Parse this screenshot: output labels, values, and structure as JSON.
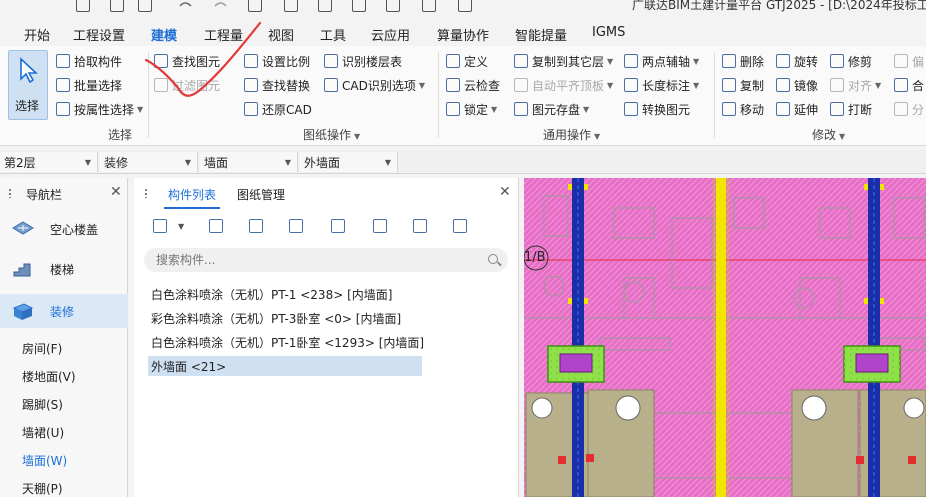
{
  "window": {
    "title": "广联达BIM土建计量平台 GTJ2025 - [D:\\2024年投标工"
  },
  "menu": {
    "tabs": [
      {
        "label": "开始"
      },
      {
        "label": "工程设置"
      },
      {
        "label": "建模",
        "active": true
      },
      {
        "label": "工程量"
      },
      {
        "label": "视图"
      },
      {
        "label": "工具"
      },
      {
        "label": "云应用"
      },
      {
        "label": "算量协作"
      },
      {
        "label": "智能提量"
      },
      {
        "label": "IGMS"
      }
    ]
  },
  "ribbon": {
    "select_group": {
      "label": "选择",
      "select_button": "选择",
      "pick_component": "拾取构件",
      "batch_select": "批量选择",
      "select_by_property": "按属性选择"
    },
    "drawing_group": {
      "label": "图纸操作",
      "find_element": "查找图元",
      "filter_element": "过滤图元",
      "set_scale": "设置比例",
      "find_replace": "查找替换",
      "restore_cad": "还原CAD",
      "identify_floor_table": "识别楼层表",
      "cad_identify_options": "CAD识别选项"
    },
    "general_group": {
      "label": "通用操作",
      "define": "定义",
      "cloud_check": "云检查",
      "lock": "锁定",
      "copy_to_other_floor": "复制到其它层",
      "auto_align_slab": "自动平齐顶板",
      "element_save": "图元存盘",
      "two_point_axis": "两点辅轴",
      "length_dimension": "长度标注",
      "convert_element": "转换图元"
    },
    "modify_group": {
      "label": "修改",
      "delete": "删除",
      "copy": "复制",
      "move": "移动",
      "rotate": "旋转",
      "mirror": "镜像",
      "extend": "延伸",
      "trim": "修剪",
      "align": "对齐",
      "break": "打断",
      "offset": "偏",
      "merge": "合",
      "split": "分"
    }
  },
  "filters": {
    "floor": "第2层",
    "category": "装修",
    "type": "墙面",
    "subtype": "外墙面"
  },
  "nav": {
    "title": "导航栏",
    "items": [
      {
        "label": "空心楼盖"
      },
      {
        "label": "楼梯"
      },
      {
        "label": "装修",
        "active": true
      }
    ],
    "sub_items": [
      {
        "label": "房间(F)"
      },
      {
        "label": "楼地面(V)"
      },
      {
        "label": "踢脚(S)"
      },
      {
        "label": "墙裙(U)"
      },
      {
        "label": "墙面(W)",
        "active": true
      },
      {
        "label": "天棚(P)"
      }
    ]
  },
  "components": {
    "tabs": [
      {
        "label": "构件列表",
        "active": true
      },
      {
        "label": "图纸管理"
      }
    ],
    "search_placeholder": "搜索构件...",
    "items": [
      {
        "label": "白色涂料喷涂（无机）PT-1 <238> [内墙面]"
      },
      {
        "label": "彩色涂料喷涂（无机）PT-3卧室 <0> [内墙面]"
      },
      {
        "label": "白色涂料喷涂（无机）PT-1卧室 <1293> [内墙面]"
      },
      {
        "label": "外墙面 <21>",
        "selected": true
      }
    ]
  },
  "canvas": {
    "axis_label": "1/B",
    "colors": {
      "background": "#e76fc7",
      "wall_blue": "#1a2ea8",
      "wall_yellow": "#f2e600",
      "equipment_green": "#6bd02a"
    }
  },
  "colors": {
    "accent": "#1d6fd6",
    "selection": "#cfe0f3",
    "annotation": "#e23b3b"
  }
}
